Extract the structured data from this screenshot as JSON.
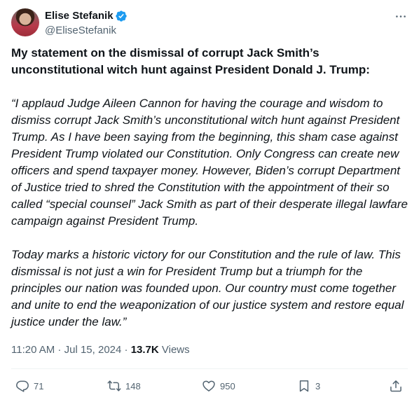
{
  "author": {
    "display_name": "Elise Stefanik",
    "handle": "@EliseStefanik",
    "verified": true
  },
  "tweet": {
    "intro": "My statement on the dismissal of corrupt Jack Smith’s unconstitutional witch hunt against President Donald J. Trump:",
    "paragraph1": "“I applaud Judge Aileen Cannon for having the courage and wisdom to dismiss corrupt Jack Smith’s unconstitutional witch hunt against President Trump. As I have been saying from the beginning, this sham case against President Trump violated our Constitution. Only Congress can create new officers and spend taxpayer money. However, Biden’s corrupt Department of Justice tried to shred the Constitution with the appointment of their so called “special counsel” Jack Smith as part of their desperate illegal lawfare campaign against President Trump.",
    "paragraph2": "Today marks a historic victory for our Constitution and the rule of law. This dismissal is not just a win for President Trump but a triumph for the principles our nation was founded upon. Our country must come together and unite to end the weaponization of our justice system and restore equal justice under the law.”"
  },
  "meta": {
    "time": "11:20 AM",
    "separator1": " · ",
    "date": "Jul 15, 2024",
    "separator2": " · ",
    "views_count": "13.7K",
    "views_label": " Views"
  },
  "actions": {
    "replies": "71",
    "reposts": "148",
    "likes": "950",
    "bookmarks": "3"
  },
  "colors": {
    "verified_blue": "#1d9bf0",
    "secondary_text": "#536471"
  }
}
